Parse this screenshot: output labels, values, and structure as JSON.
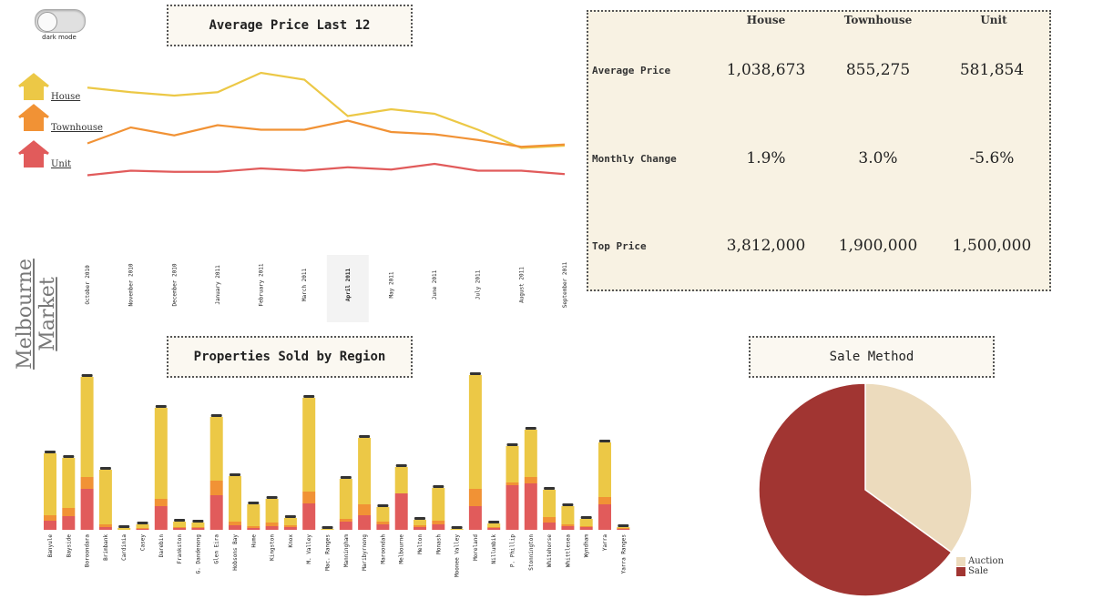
{
  "toggle": {
    "label": "dark mode"
  },
  "vertical_title": "Melbourne Market",
  "line_chart_title": "Average Price Last 12",
  "bar_chart_title": "Properties Sold by Region",
  "pie_chart_title": "Sale Method",
  "legend": [
    {
      "label": "House",
      "color": "#ecc846"
    },
    {
      "label": "Townhouse",
      "color": "#f19235"
    },
    {
      "label": "Unit",
      "color": "#e15b5b"
    }
  ],
  "stats": {
    "columns": [
      "House",
      "Townhouse",
      "Unit"
    ],
    "rows": [
      {
        "label": "Average Price",
        "values": [
          "1,038,673",
          "855,275",
          "581,854"
        ]
      },
      {
        "label": "Monthly Change",
        "values": [
          "1.9%",
          "3.0%",
          "-5.6%"
        ]
      },
      {
        "label": "Top Price",
        "values": [
          "3,812,000",
          "1,900,000",
          "1,500,000"
        ]
      }
    ]
  },
  "chart_data": [
    {
      "type": "line",
      "title": "Average Price Last 12",
      "categories": [
        "October 2010",
        "November 2010",
        "December 2010",
        "January 2011",
        "February 2011",
        "March 2011",
        "April 2011",
        "May 2011",
        "June 2011",
        "July 2011",
        "August 2011",
        "September 2011"
      ],
      "highlighted": "April 2011",
      "series": [
        {
          "name": "House",
          "color": "#ecc846",
          "values": [
            1.35,
            1.31,
            1.28,
            1.31,
            1.48,
            1.42,
            1.1,
            1.16,
            1.12,
            0.98,
            0.82,
            0.84
          ]
        },
        {
          "name": "Townhouse",
          "color": "#f19235",
          "values": [
            0.86,
            1.0,
            0.93,
            1.02,
            0.98,
            0.98,
            1.06,
            0.96,
            0.94,
            0.89,
            0.83,
            0.85
          ]
        },
        {
          "name": "Unit",
          "color": "#e15b5b",
          "values": [
            0.58,
            0.62,
            0.61,
            0.61,
            0.64,
            0.62,
            0.65,
            0.63,
            0.68,
            0.62,
            0.62,
            0.59
          ]
        }
      ],
      "ylim": [
        0.4,
        1.6
      ]
    },
    {
      "type": "bar",
      "title": "Properties Sold by Region",
      "stacked": true,
      "categories": [
        "Banyule",
        "Bayside",
        "Boroondara",
        "Brimbank",
        "Cardinia",
        "Casey",
        "Darebin",
        "Frankston",
        "G. Dandenong",
        "Glen Eira",
        "Hobsons Bay",
        "Hume",
        "Kingston",
        "Knox",
        "M. Valley",
        "Mac. Ranges",
        "Manningham",
        "Maribyrnong",
        "Maroondah",
        "Melbourne",
        "Melton",
        "Monash",
        "Moonee Valley",
        "Moreland",
        "Nillumbik",
        "P. Phillip",
        "Stonnington",
        "Whitehorse",
        "Whittlesea",
        "Wyndham",
        "Yarra",
        "Yarra Ranges"
      ],
      "series": [
        {
          "name": "Unit",
          "color": "#e15b5b",
          "values": [
            10,
            15,
            45,
            3,
            0,
            1,
            26,
            2,
            2,
            38,
            5,
            2,
            4,
            3,
            29,
            0,
            9,
            16,
            6,
            40,
            3,
            6,
            0,
            26,
            2,
            49,
            51,
            8,
            4,
            3,
            28,
            1
          ]
        },
        {
          "name": "Townhouse",
          "color": "#f19235",
          "values": [
            6,
            9,
            13,
            3,
            0,
            1,
            8,
            1,
            1,
            16,
            4,
            2,
            4,
            2,
            13,
            0,
            3,
            12,
            3,
            0,
            2,
            4,
            0,
            19,
            1,
            3,
            7,
            6,
            2,
            1,
            8,
            1
          ]
        },
        {
          "name": "House",
          "color": "#ecc846",
          "values": [
            68,
            55,
            110,
            60,
            2,
            4,
            100,
            6,
            5,
            70,
            50,
            24,
            26,
            8,
            103,
            1,
            44,
            73,
            16,
            29,
            6,
            36,
            1,
            125,
            4,
            40,
            52,
            30,
            20,
            8,
            60,
            1
          ]
        }
      ]
    },
    {
      "type": "pie",
      "title": "Sale Method",
      "series": [
        {
          "name": "Auction",
          "color": "#ecdbbd",
          "value": 35
        },
        {
          "name": "Sale",
          "color": "#a13532",
          "value": 65
        }
      ]
    }
  ]
}
